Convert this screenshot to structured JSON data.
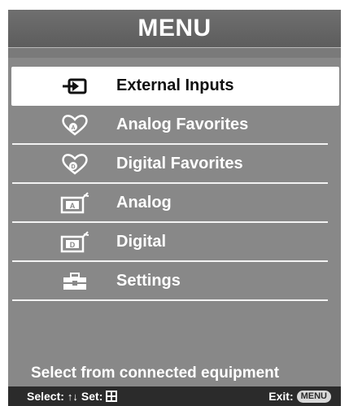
{
  "header": {
    "title": "MENU"
  },
  "menu": {
    "items": [
      {
        "label": "External Inputs",
        "icon": "external-input-icon",
        "selected": true
      },
      {
        "label": "Analog Favorites",
        "icon": "analog-favorites-heart-icon",
        "selected": false
      },
      {
        "label": "Digital Favorites",
        "icon": "digital-favorites-heart-icon",
        "selected": false
      },
      {
        "label": "Analog",
        "icon": "analog-tv-icon",
        "selected": false
      },
      {
        "label": "Digital",
        "icon": "digital-tv-icon",
        "selected": false
      },
      {
        "label": "Settings",
        "icon": "settings-toolbox-icon",
        "selected": false
      }
    ]
  },
  "description": "Select from connected equipment",
  "footer": {
    "select_label": "Select:",
    "select_arrows": "↑↓",
    "set_label": "Set:",
    "exit_label": "Exit:",
    "exit_button": "MENU"
  },
  "colors": {
    "background": "#888888",
    "header": "#666666",
    "selected": "#ffffff",
    "footer": "#2b2b2b"
  }
}
